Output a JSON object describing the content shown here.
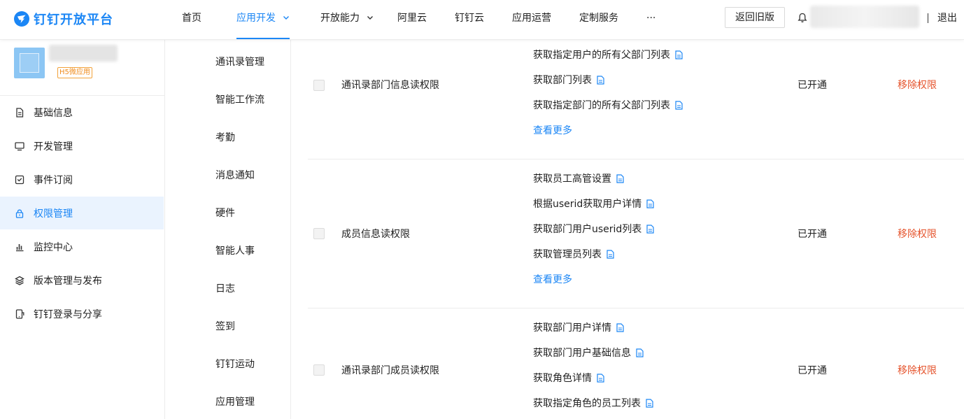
{
  "brand": {
    "name": "钉钉开放平台",
    "color": "#1b86f5"
  },
  "nav": {
    "items": [
      {
        "label": "首页",
        "icon": null
      },
      {
        "label": "应用开发",
        "icon": "chevron-down-icon",
        "active": true
      },
      {
        "label": "开放能力",
        "icon": "chevron-down-icon"
      },
      {
        "label": "阿里云"
      },
      {
        "label": "钉钉云"
      },
      {
        "label": "应用运营"
      },
      {
        "label": "定制服务"
      },
      {
        "label": "···"
      }
    ],
    "back_button": "返回旧版",
    "logout": "退出"
  },
  "app": {
    "badge": "H5微应用"
  },
  "sidebar": {
    "items": [
      {
        "label": "基础信息",
        "icon": "document-icon"
      },
      {
        "label": "开发管理",
        "icon": "monitor-icon"
      },
      {
        "label": "事件订阅",
        "icon": "inbox-icon"
      },
      {
        "label": "权限管理",
        "icon": "lock-icon",
        "active": true
      },
      {
        "label": "监控中心",
        "icon": "bar-chart-icon"
      },
      {
        "label": "版本管理与发布",
        "icon": "layers-icon"
      },
      {
        "label": "钉钉登录与分享",
        "icon": "phone-share-icon"
      }
    ]
  },
  "categories": [
    "通讯录管理",
    "智能工作流",
    "考勤",
    "消息通知",
    "硬件",
    "智能人事",
    "日志",
    "签到",
    "钉钉运动",
    "应用管理"
  ],
  "permissions": [
    {
      "name": "通讯录部门信息读权限",
      "apis": [
        "获取指定用户的所有父部门列表",
        "获取部门列表",
        "获取指定部门的所有父部门列表"
      ],
      "more": "查看更多",
      "status": "已开通",
      "action": "移除权限"
    },
    {
      "name": "成员信息读权限",
      "apis": [
        "获取员工高管设置",
        "根据userid获取用户详情",
        "获取部门用户userid列表",
        "获取管理员列表"
      ],
      "more": "查看更多",
      "status": "已开通",
      "action": "移除权限"
    },
    {
      "name": "通讯录部门成员读权限",
      "apis": [
        "获取部门用户详情",
        "获取部门用户基础信息",
        "获取角色详情",
        "获取指定角色的员工列表"
      ],
      "status": "已开通",
      "action": "移除权限"
    }
  ],
  "colors": {
    "accent": "#1b86f5",
    "danger": "#e5532c",
    "badge": "#f08c1d"
  }
}
